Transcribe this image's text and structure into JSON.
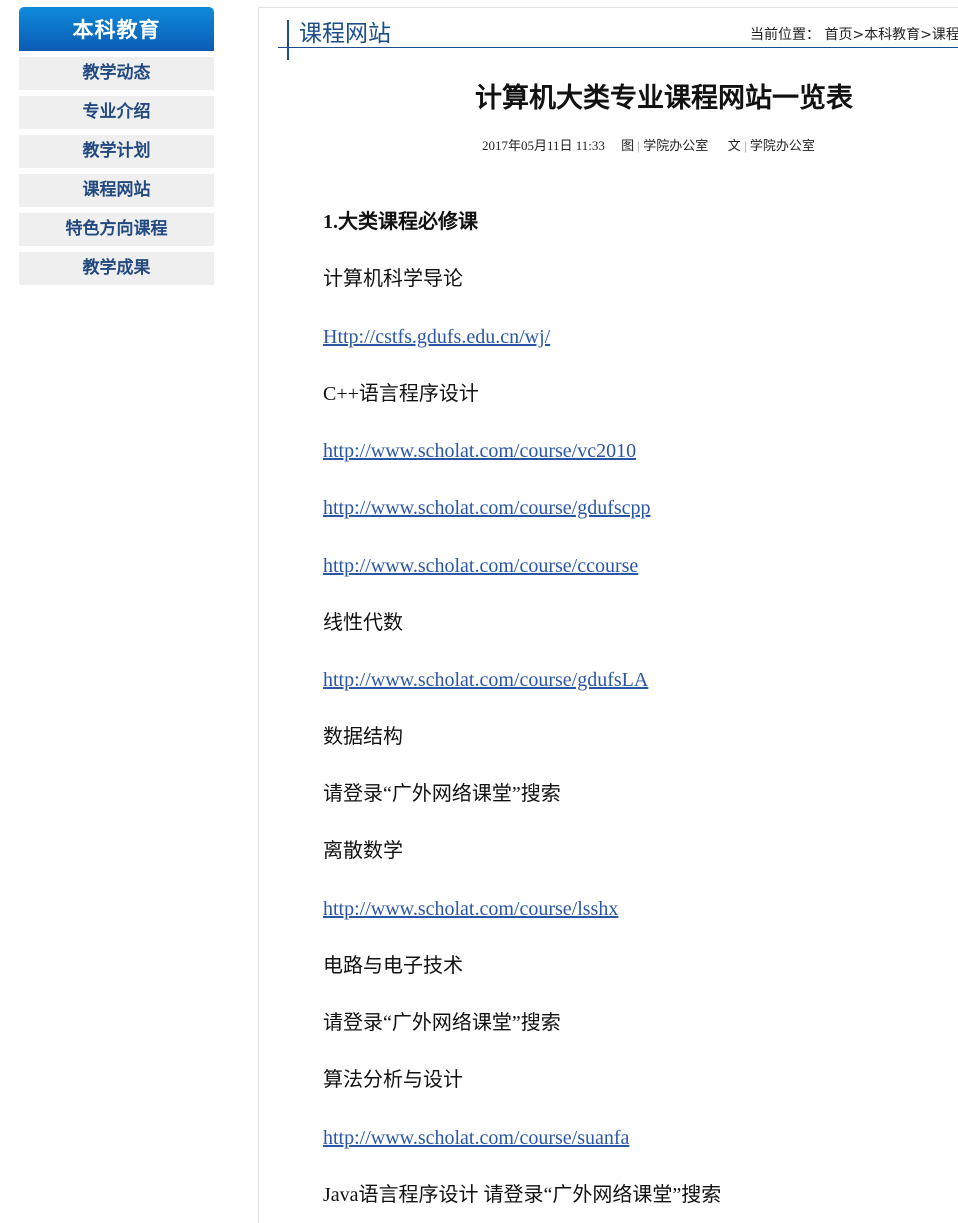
{
  "sidebar": {
    "title": "本科教育",
    "items": [
      {
        "label": "教学动态"
      },
      {
        "label": "专业介绍"
      },
      {
        "label": "教学计划"
      },
      {
        "label": "课程网站"
      },
      {
        "label": "特色方向课程"
      },
      {
        "label": "教学成果"
      }
    ]
  },
  "header": {
    "column_title": "课程网站",
    "breadcrumb_label": "当前位置：",
    "breadcrumb_home": "首页",
    "breadcrumb_sep1": ">",
    "breadcrumb_section": "本科教育",
    "breadcrumb_sep2": ">",
    "breadcrumb_current": "课程"
  },
  "article": {
    "title": "计算机大类专业课程网站一览表",
    "date": "2017年05月11日 11:33",
    "image_label": "图",
    "image_source": "学院办公室",
    "text_label": "文",
    "text_source": "学院办公室",
    "sep": "|",
    "lines": [
      {
        "text": "1.大类课程必修课"
      },
      {
        "text": "计算机科学导论"
      },
      {
        "text": "Http://cstfs.gdufs.edu.cn/wj/"
      },
      {
        "text": "C++语言程序设计"
      },
      {
        "text": "http://www.scholat.com/course/vc2010"
      },
      {
        "text": "http://www.scholat.com/course/gdufscpp"
      },
      {
        "text": "http://www.scholat.com/course/ccourse"
      },
      {
        "text": "线性代数"
      },
      {
        "text": "http://www.scholat.com/course/gdufsLA"
      },
      {
        "text": "数据结构"
      },
      {
        "text": "请登录“广外网络课堂”搜索"
      },
      {
        "text": "离散数学"
      },
      {
        "text": "http://www.scholat.com/course/lsshx"
      },
      {
        "text": "电路与电子技术"
      },
      {
        "text": "请登录“广外网络课堂”搜索"
      },
      {
        "text": "算法分析与设计"
      },
      {
        "text": "http://www.scholat.com/course/suanfa"
      },
      {
        "text": "Java语言程序设计 请登录“广外网络课堂”搜索"
      }
    ]
  }
}
